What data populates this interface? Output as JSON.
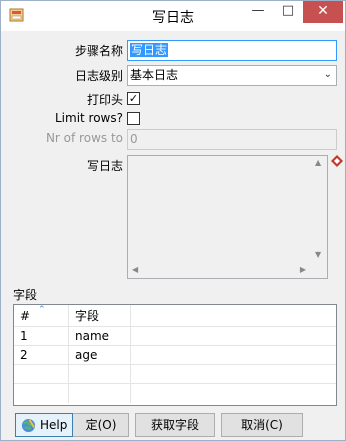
{
  "window": {
    "title": "写日志"
  },
  "form": {
    "step_name_label": "步骤名称",
    "step_name_value": "写日志",
    "log_level_label": "日志级别",
    "log_level_value": "基本日志",
    "print_header_label": "打印头",
    "print_header_checked": true,
    "limit_rows_label": "Limit rows?",
    "limit_rows_checked": false,
    "nr_rows_label": "Nr of rows to",
    "nr_rows_value": "0",
    "write_log_label": "写日志"
  },
  "fields": {
    "section_label": "字段",
    "columns": [
      "#",
      "字段"
    ],
    "rows": [
      {
        "num": "1",
        "field": "name"
      },
      {
        "num": "2",
        "field": "age"
      }
    ]
  },
  "buttons": {
    "help": "Help",
    "ok": "确定(O)",
    "ok_visible": "定(O)",
    "get_fields": "获取字段",
    "cancel": "取消(C)"
  },
  "colors": {
    "selection": "#3399ff",
    "close_button": "#c75050",
    "diamond_icon": "#c0392b"
  }
}
